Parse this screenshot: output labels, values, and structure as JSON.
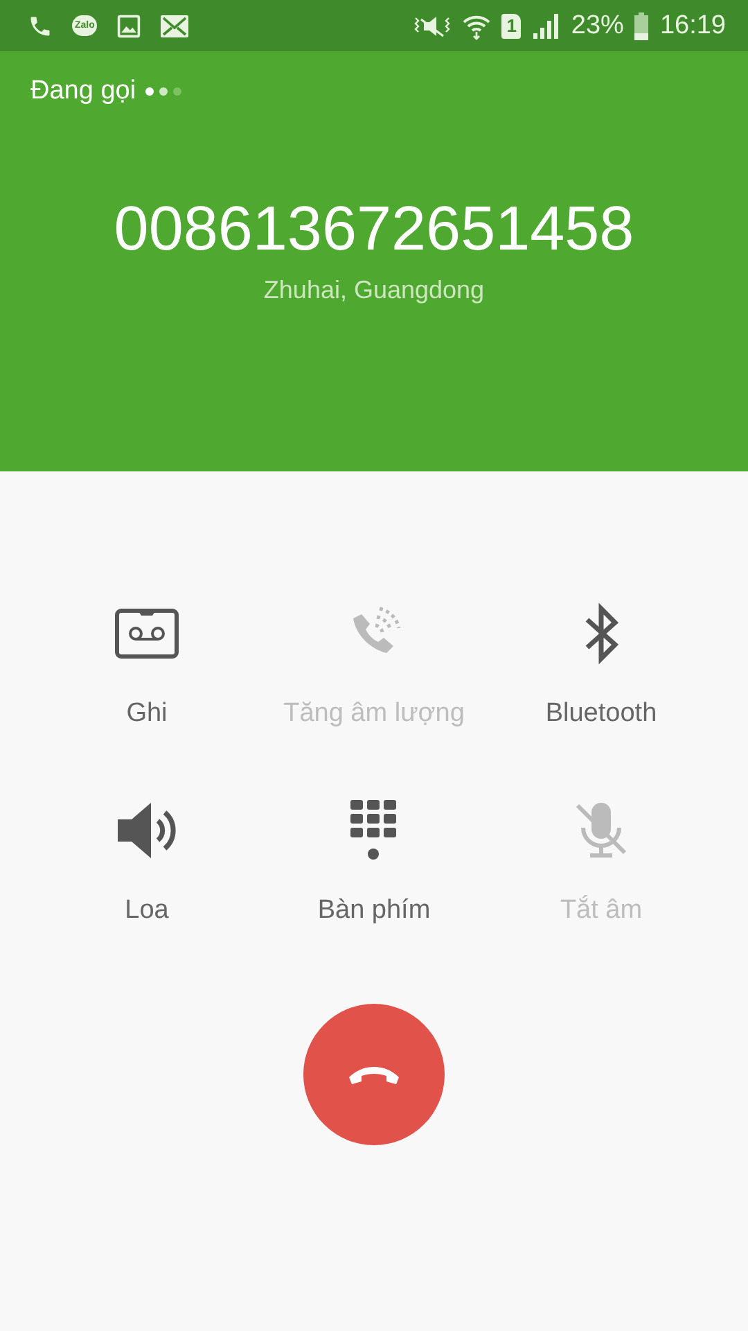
{
  "status_bar": {
    "notifications": [
      {
        "kind": "phone"
      },
      {
        "kind": "chat",
        "label": "Zalo"
      },
      {
        "kind": "image"
      },
      {
        "kind": "mail"
      }
    ],
    "sim_label": "1",
    "battery_percent": "23%",
    "time": "16:19"
  },
  "call": {
    "status": "Đang gọi",
    "number": "008613672651458",
    "location": "Zhuhai, Guangdong"
  },
  "actions": [
    {
      "kind": "record",
      "label": "Ghi",
      "disabled": false
    },
    {
      "kind": "volume",
      "label": "Tăng âm lượng",
      "disabled": true
    },
    {
      "kind": "bluetooth",
      "label": "Bluetooth",
      "disabled": false
    },
    {
      "kind": "speaker",
      "label": "Loa",
      "disabled": false
    },
    {
      "kind": "keypad",
      "label": "Bàn phím",
      "disabled": false
    },
    {
      "kind": "mute",
      "label": "Tắt âm",
      "disabled": true
    }
  ]
}
